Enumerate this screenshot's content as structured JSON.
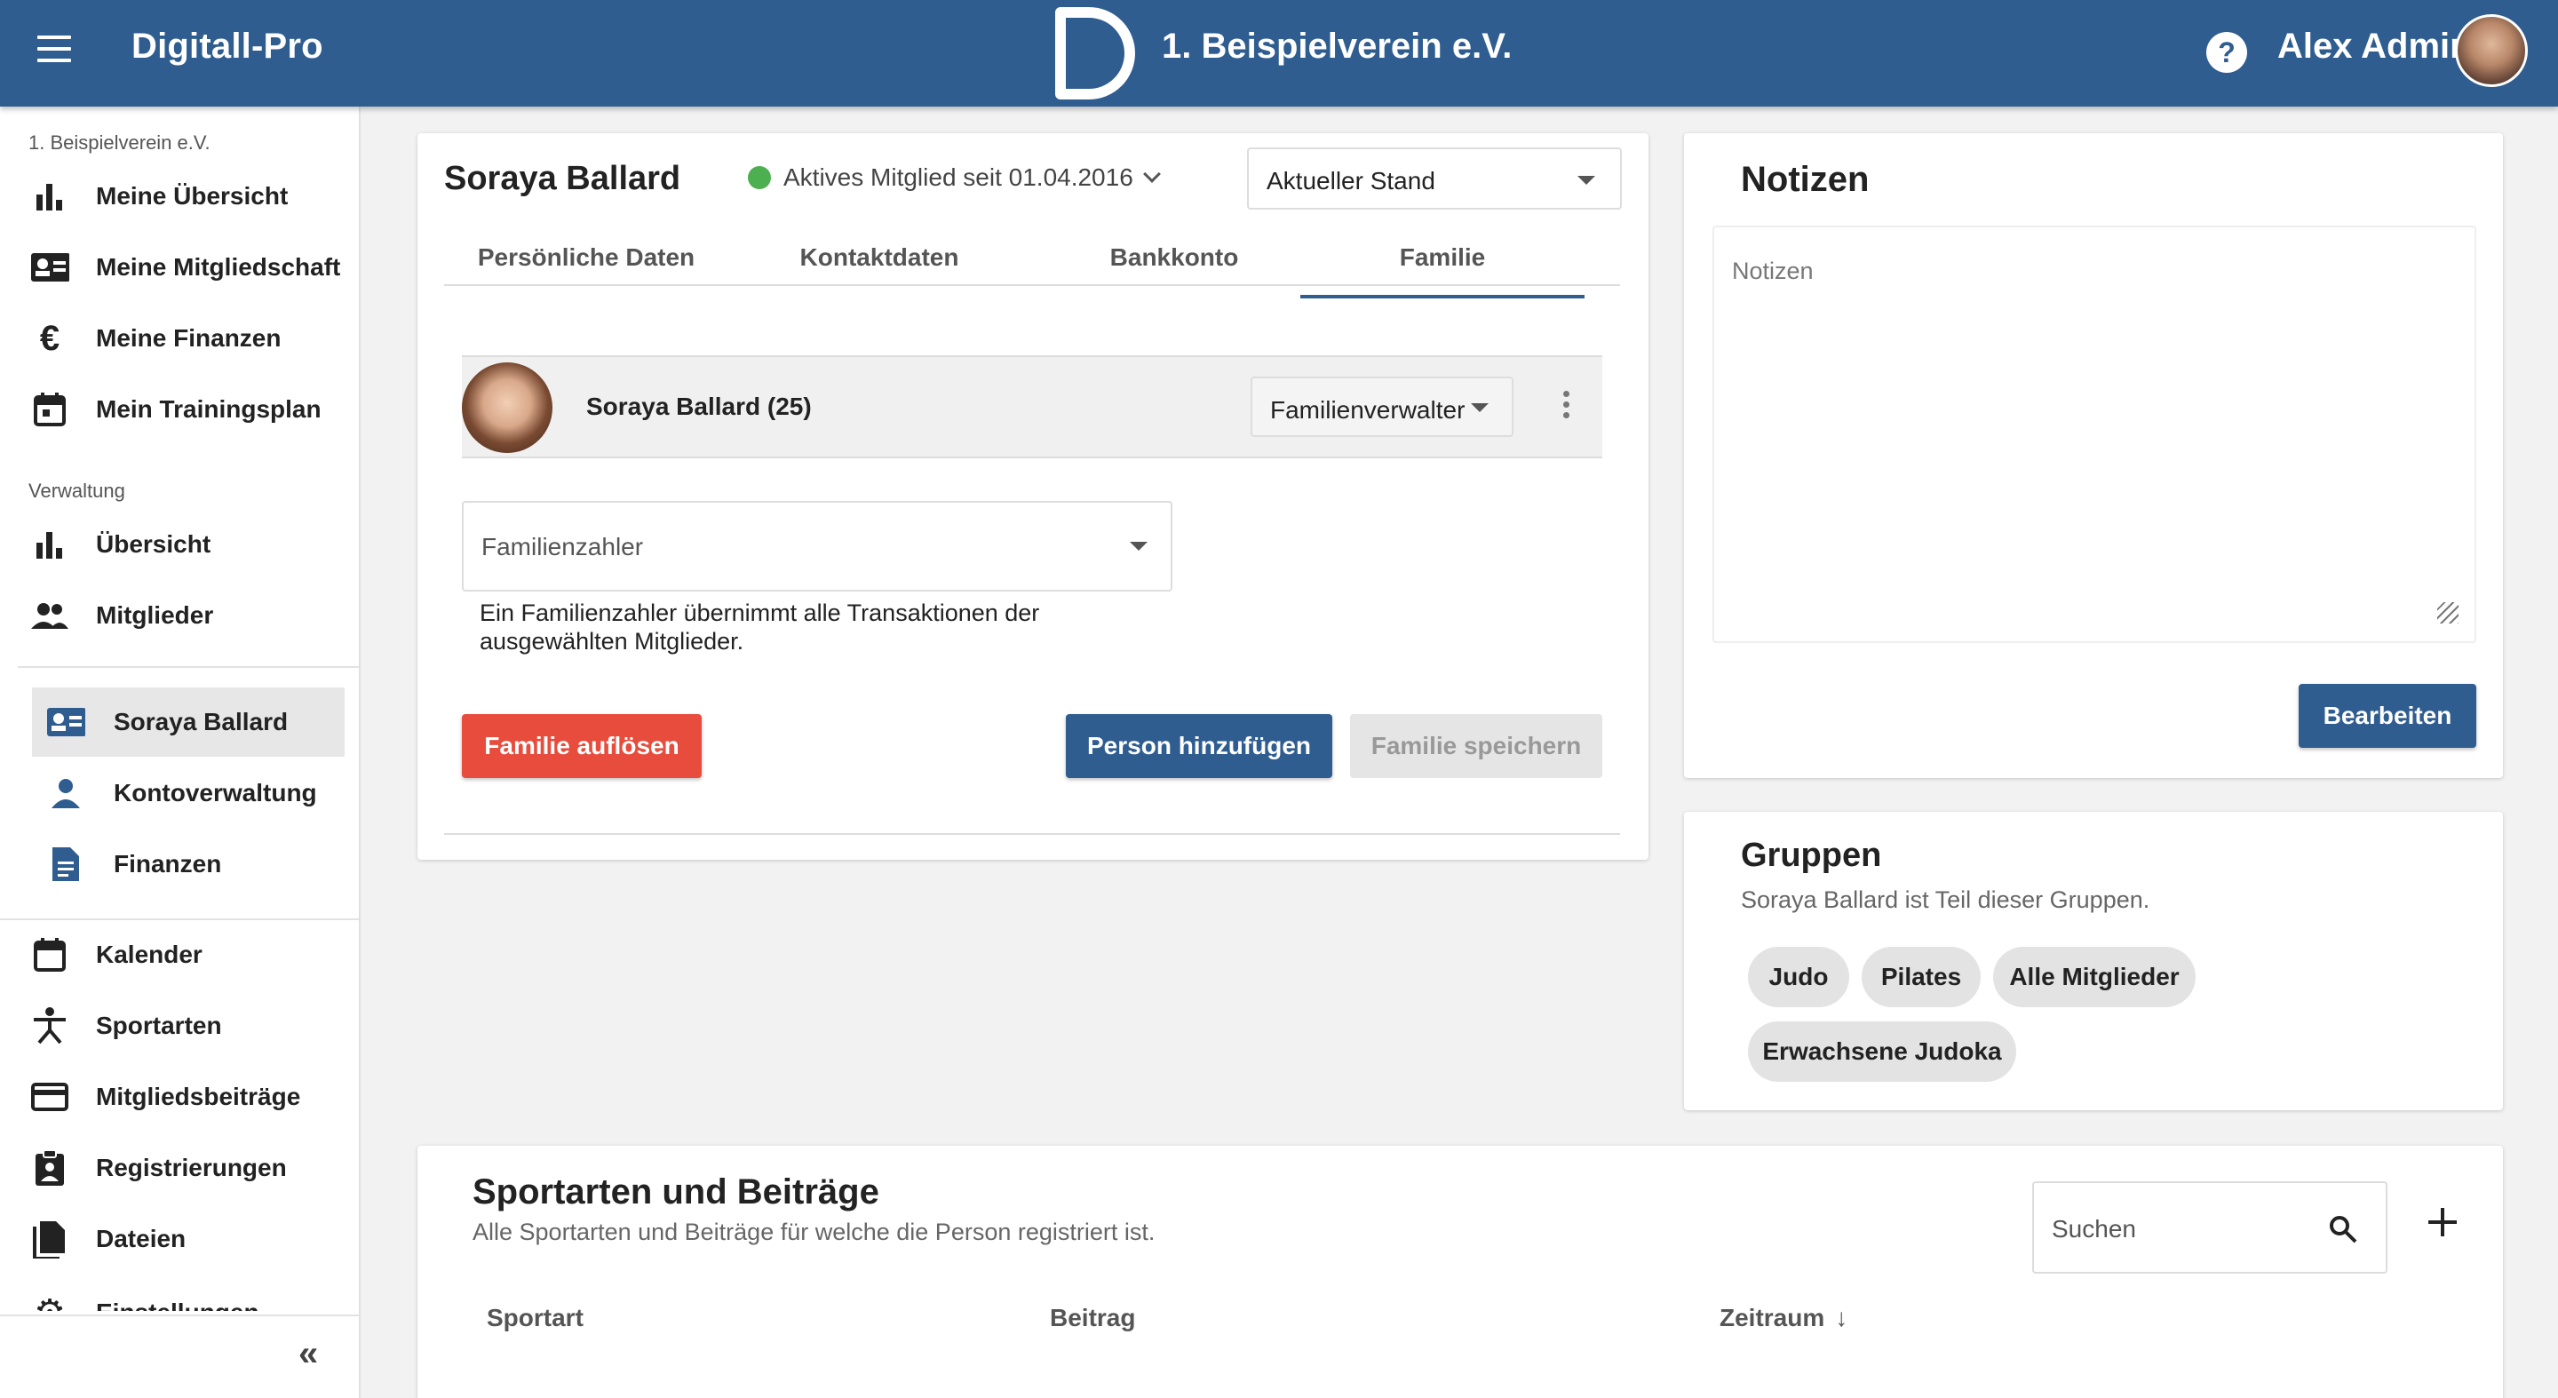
{
  "app": {
    "brand": "Digitall-Pro",
    "club_title": "1. Beispielverein e.V.",
    "user_name": "Alex Admin"
  },
  "sidebar": {
    "club_label": "1. Beispielverein e.V.",
    "section_admin": "Verwaltung",
    "items": [
      {
        "label": "Meine Übersicht",
        "icon": "bar-chart-icon"
      },
      {
        "label": "Meine Mitgliedschaft",
        "icon": "member-card-icon"
      },
      {
        "label": "Meine Finanzen",
        "icon": "euro-icon"
      },
      {
        "label": "Mein Trainingsplan",
        "icon": "calendar-icon"
      },
      {
        "label": "Übersicht",
        "icon": "bar-chart-icon"
      },
      {
        "label": "Mitglieder",
        "icon": "people-icon"
      },
      {
        "label": "Soraya Ballard",
        "icon": "member-card-icon"
      },
      {
        "label": "Kontoverwaltung",
        "icon": "person-icon"
      },
      {
        "label": "Finanzen",
        "icon": "document-icon"
      },
      {
        "label": "Kalender",
        "icon": "calendar-icon"
      },
      {
        "label": "Sportarten",
        "icon": "sport-icon"
      },
      {
        "label": "Mitgliedsbeiträge",
        "icon": "credit-card-icon"
      },
      {
        "label": "Registrierungen",
        "icon": "clipboard-icon"
      },
      {
        "label": "Dateien",
        "icon": "files-icon"
      },
      {
        "label": "Einstellungen",
        "icon": "gear-icon"
      }
    ]
  },
  "member": {
    "name": "Soraya Ballard",
    "status": "Aktives Mitglied seit 01.04.2016",
    "status_color": "#4caf50",
    "stand_select": "Aktueller Stand",
    "tabs": [
      "Persönliche Daten",
      "Kontaktdaten",
      "Bankkonto",
      "Familie"
    ],
    "active_tab": "Familie",
    "family_member": "Soraya Ballard (25)",
    "family_role": "Familienverwalter",
    "payer_placeholder": "Familienzahler",
    "payer_hint": "Ein Familienzahler übernimmt alle Transaktionen der ausgewählten Mitglieder.",
    "btn_dissolve": "Familie auflösen",
    "btn_add_person": "Person hinzufügen",
    "btn_save_family": "Familie speichern"
  },
  "notes": {
    "title": "Notizen",
    "placeholder": "Notizen",
    "btn_edit": "Bearbeiten"
  },
  "groups": {
    "title": "Gruppen",
    "subtitle": "Soraya Ballard ist Teil dieser Gruppen.",
    "chips": [
      "Judo",
      "Pilates",
      "Alle Mitglieder",
      "Erwachsene Judoka"
    ]
  },
  "sports": {
    "title": "Sportarten und Beiträge",
    "subtitle": "Alle Sportarten und Beiträge für welche die Person registriert ist.",
    "search_placeholder": "Suchen",
    "columns": [
      "Sportart",
      "Beitrag",
      "Zeitraum"
    ]
  },
  "colors": {
    "primary": "#2f5d90",
    "danger": "#e74c3c"
  }
}
